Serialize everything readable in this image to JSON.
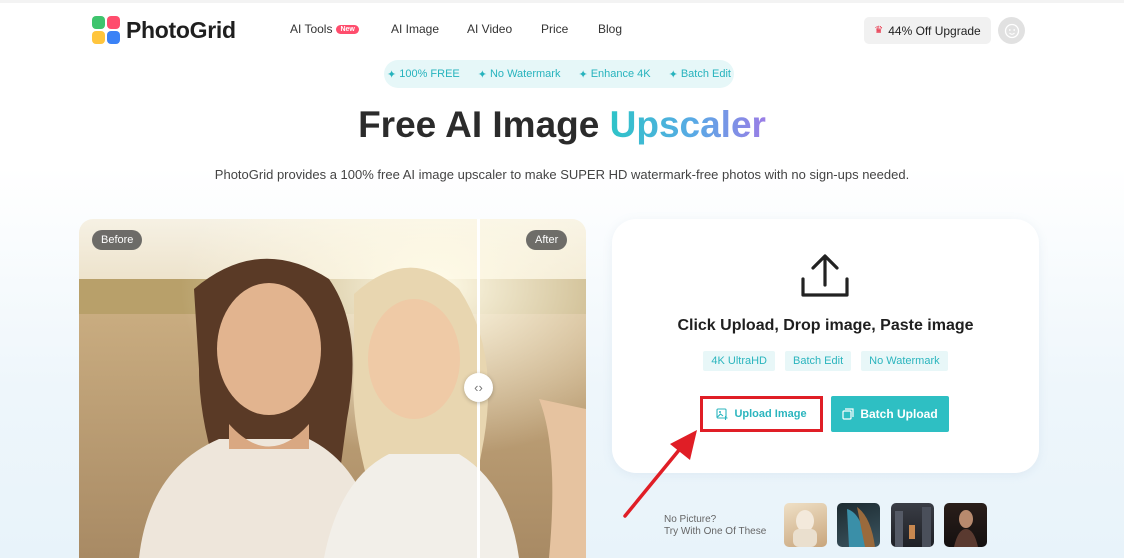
{
  "header": {
    "logo_text": "PhotoGrid",
    "nav": [
      {
        "label": "AI Tools",
        "badge": "New"
      },
      {
        "label": "AI Image"
      },
      {
        "label": "AI Video"
      },
      {
        "label": "Price"
      },
      {
        "label": "Blog"
      }
    ],
    "upgrade_label": "44% Off Upgrade"
  },
  "features": [
    "100% FREE",
    "No Watermark",
    "Enhance 4K",
    "Batch Edit"
  ],
  "hero": {
    "title_main": "Free AI Image",
    "title_accent": "Upscaler",
    "subtitle": "PhotoGrid provides a 100% free AI image upscaler to make SUPER HD watermark-free photos with no sign-ups needed."
  },
  "compare": {
    "before_label": "Before",
    "after_label": "After"
  },
  "upload": {
    "title": "Click Upload, Drop image, Paste image",
    "tags": [
      "4K UltraHD",
      "Batch Edit",
      "No Watermark"
    ],
    "upload_button": "Upload Image",
    "batch_button": "Batch Upload"
  },
  "samples": {
    "line1": "No Picture?",
    "line2": "Try With One Of These"
  },
  "colors": {
    "accent_teal": "#2ebfc3",
    "highlight_red": "#e01e26"
  }
}
